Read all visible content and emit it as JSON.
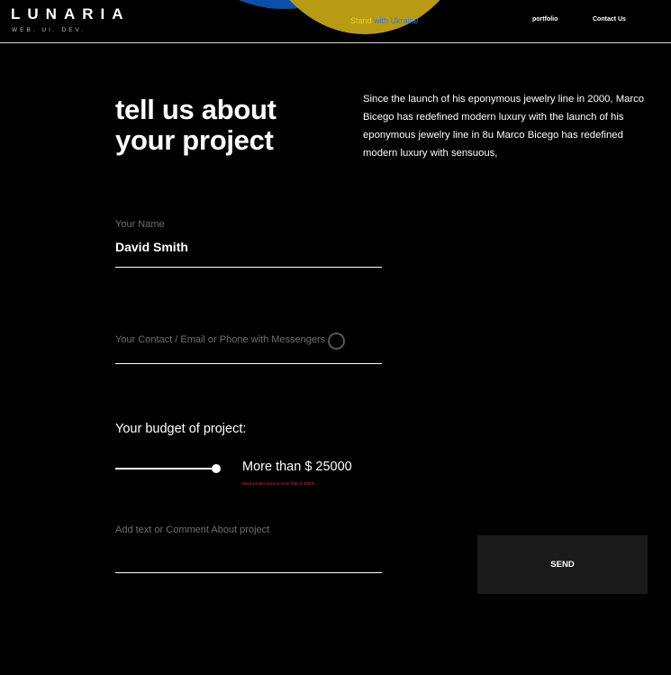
{
  "header": {
    "logo": "LUNARIA",
    "tagline": "WEB. UI. DEV.",
    "banner_stand": "Stand",
    "banner_with": " with Ukraine",
    "nav": {
      "portfolio": "portfolio",
      "contact": "Contact Us"
    }
  },
  "main": {
    "title_line1": "tell us about",
    "title_line2": "your project",
    "intro": "Since the launch of his eponymous jewelry line in 2000, Marco Bicego has redefined modern luxury with the launch of his eponymous jewelry line in 8u Marco Bicego has redefined modern luxury with sensuous,"
  },
  "form": {
    "name_label": "Your Name",
    "name_value": "David Smith",
    "contact_label": "Your Contact / Email or Phone with Messengers",
    "budget_label": "Your budget of project:",
    "budget_value": "More than $ 25000",
    "budget_note": "Basic project price is more than $ 25000",
    "budget_slider_fraction": 1.0,
    "comment_label": "Add text or Comment About project",
    "send_label": "SEND"
  },
  "colors": {
    "background": "#000000",
    "accent_blue": "#0b4fa8",
    "accent_yellow": "#b99a14",
    "note_red": "#e32a2a"
  }
}
